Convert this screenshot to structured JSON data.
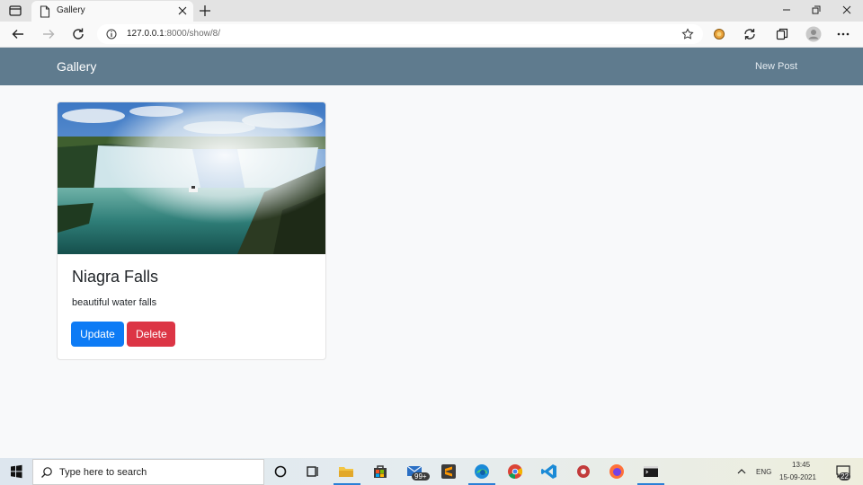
{
  "browser": {
    "tab_title": "Gallery",
    "url_host": "127.0.0.1",
    "url_path": ":8000/show/8/",
    "icons": [
      "tab-actions-icon",
      "page-icon",
      "close-icon",
      "plus-icon",
      "back-icon",
      "forward-icon",
      "reload-icon",
      "info-icon",
      "favorite-icon",
      "extension-icon",
      "sync-icon",
      "collections-icon",
      "profile-icon",
      "more-icon",
      "minimize-icon",
      "restore-icon",
      "window-close-icon"
    ]
  },
  "site": {
    "brand": "Gallery",
    "nav_new_post": "New Post",
    "header_color": "#5f7b8e"
  },
  "post": {
    "title": "Niagra Falls",
    "description": "beautiful water falls",
    "update_label": "Update",
    "delete_label": "Delete",
    "update_color": "#0d7bf5",
    "delete_color": "#dc3545"
  },
  "taskbar": {
    "search_placeholder": "Type here to search",
    "mail_badge": "99+",
    "language": "ENG",
    "time": "13:45",
    "date": "15-09-2021",
    "notification_count": "22"
  }
}
